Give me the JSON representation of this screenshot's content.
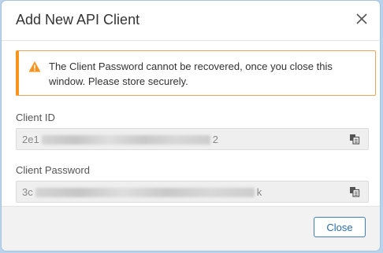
{
  "dialog": {
    "title": "Add New API Client",
    "close_icon": "close-icon"
  },
  "alert": {
    "icon": "warning-icon",
    "color": "#f7941e",
    "text": "The Client Password cannot be recovered, once you close this window. Please store securely."
  },
  "fields": {
    "client_id": {
      "label": "Client ID",
      "value_prefix": "2e1",
      "value_suffix": "2",
      "copy_icon": "copy-icon"
    },
    "client_password": {
      "label": "Client Password",
      "value_prefix": "3c",
      "value_suffix": "k",
      "copy_icon": "copy-icon"
    }
  },
  "footer": {
    "close_label": "Close",
    "accent": "#2b6cb0"
  }
}
